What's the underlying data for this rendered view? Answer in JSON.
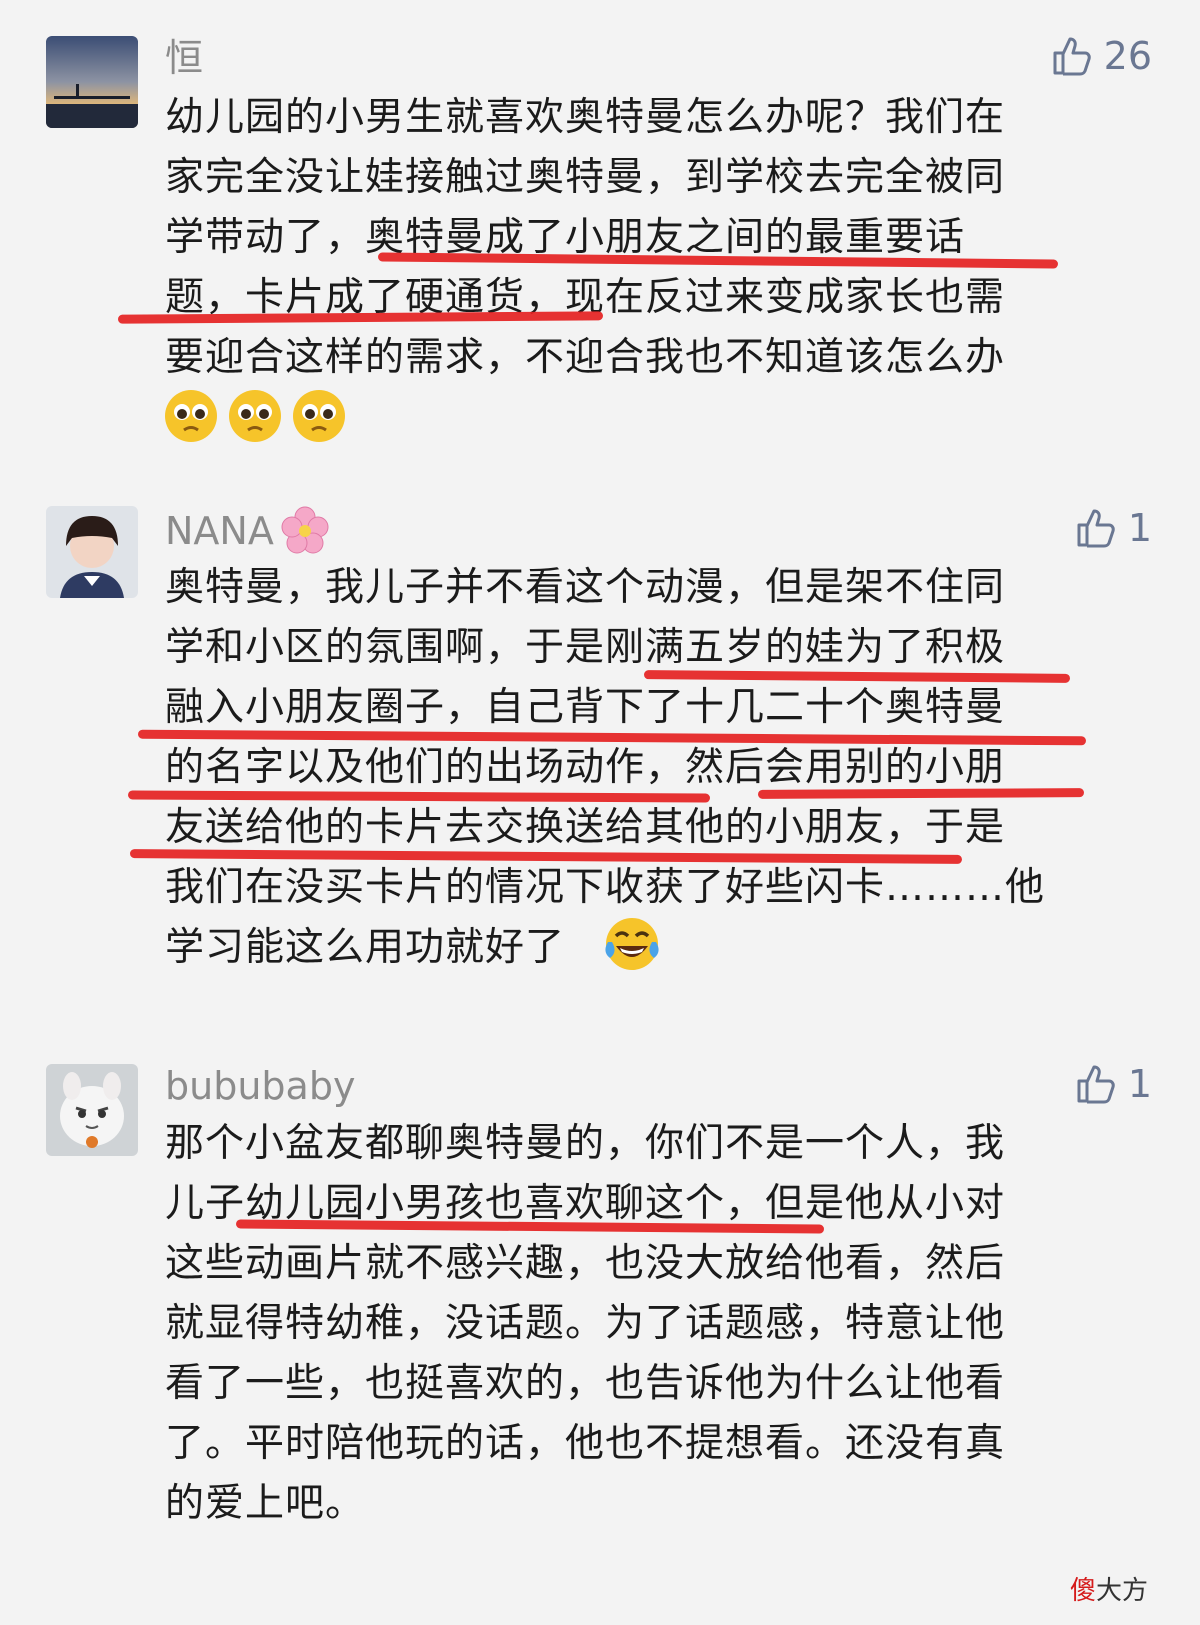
{
  "comments": [
    {
      "username": "恒",
      "likes": "26",
      "text": "幼儿园的小男生就喜欢奥特曼怎么办呢？我们在\n家完全没让娃接触过奥特曼，到学校去完全被同\n学带动了，奥特曼成了小朋友之间的最重要话\n题，卡片成了硬通货，现在反过来变成家长也需\n要迎合这样的需求，不迎合我也不知道该怎么办",
      "emojis": [
        "pleading-face",
        "pleading-face",
        "pleading-face"
      ]
    },
    {
      "username": "NANA",
      "username_emoji": "cherry-blossom",
      "likes": "1",
      "text": "奥特曼，我儿子并不看这个动漫，但是架不住同\n学和小区的氛围啊，于是刚满五岁的娃为了积极\n融入小朋友圈子，自己背下了十几二十个奥特曼\n的名字以及他们的出场动作，然后会用别的小朋\n友送给他的卡片去交换送给其他的小朋友，于是\n我们在没买卡片的情况下收获了好些闪卡………他\n学习能这么用功就好了",
      "emojis": [
        "tears-of-joy-face"
      ]
    },
    {
      "username": "bububaby",
      "likes": "1",
      "text": "那个小盆友都聊奥特曼的，你们不是一个人，我\n儿子幼儿园小男孩也喜欢聊这个，但是他从小对\n这些动画片就不感兴趣，也没大放给他看，然后\n就显得特幼稚，没话题。为了话题感，特意让他\n看了一些，也挺喜欢的，也告诉他为什么让他看\n了。平时陪他玩的话，他也不提想看。还没有真\n的爱上吧。"
    }
  ],
  "watermark": {
    "mark": "傻",
    "text": "大方"
  },
  "colors": {
    "highlight": "#e52222",
    "username": "#8b8b8b",
    "like": "#6a7792"
  }
}
